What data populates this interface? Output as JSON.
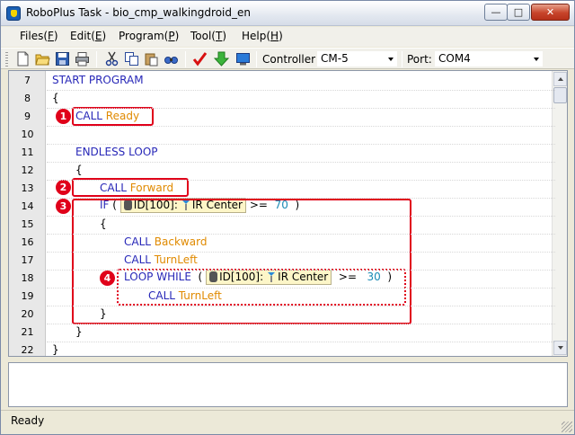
{
  "window": {
    "title": "RoboPlus Task - bio_cmp_walkingdroid_en",
    "min_glyph": "—",
    "max_glyph": "□",
    "close_glyph": "✕"
  },
  "menu": [
    {
      "label": "Files(",
      "key": "F",
      "suffix": ")"
    },
    {
      "label": "Edit(",
      "key": "E",
      "suffix": ")"
    },
    {
      "label": "Program(",
      "key": "P",
      "suffix": ")"
    },
    {
      "label": "Tool(",
      "key": "T",
      "suffix": ")"
    },
    {
      "label": "Help(",
      "key": "H",
      "suffix": ")"
    }
  ],
  "toolbar": {
    "icons": [
      "new-file-icon",
      "open-folder-icon",
      "save-icon",
      "print-icon",
      "cut-icon",
      "copy-icon",
      "paste-icon",
      "find-icon",
      "compile-check-icon",
      "download-icon",
      "monitor-icon"
    ],
    "controller_label": "Controller:",
    "controller_value": "CM-5",
    "port_label": "Port:",
    "port_value": "COM4"
  },
  "code": {
    "line_numbers": [
      "7",
      "8",
      "9",
      "10",
      "11",
      "12",
      "13",
      "14",
      "15",
      "16",
      "17",
      "18",
      "19",
      "20",
      "21",
      "22"
    ],
    "start_program": "START PROGRAM",
    "open_brace": "{",
    "close_brace": "}",
    "call": "CALL",
    "ready": "Ready",
    "endless_loop": "ENDLESS LOOP",
    "forward": "Forward",
    "if": "IF",
    "paren_open": "(",
    "paren_close": ")",
    "device_id": "ID[100]:",
    "sensor": "IR Center",
    "op_ge": ">=",
    "value_70": "70",
    "backward": "Backward",
    "turnleft": "TurnLeft",
    "loop_while": "LOOP WHILE",
    "value_30": "30"
  },
  "annotations": [
    "1",
    "2",
    "3",
    "4"
  ],
  "status": {
    "text": "Ready"
  },
  "colors": {
    "keyword": "#2828b8",
    "function": "#e08a00",
    "number": "#1a8ab5",
    "annotation": "#e0001a"
  }
}
